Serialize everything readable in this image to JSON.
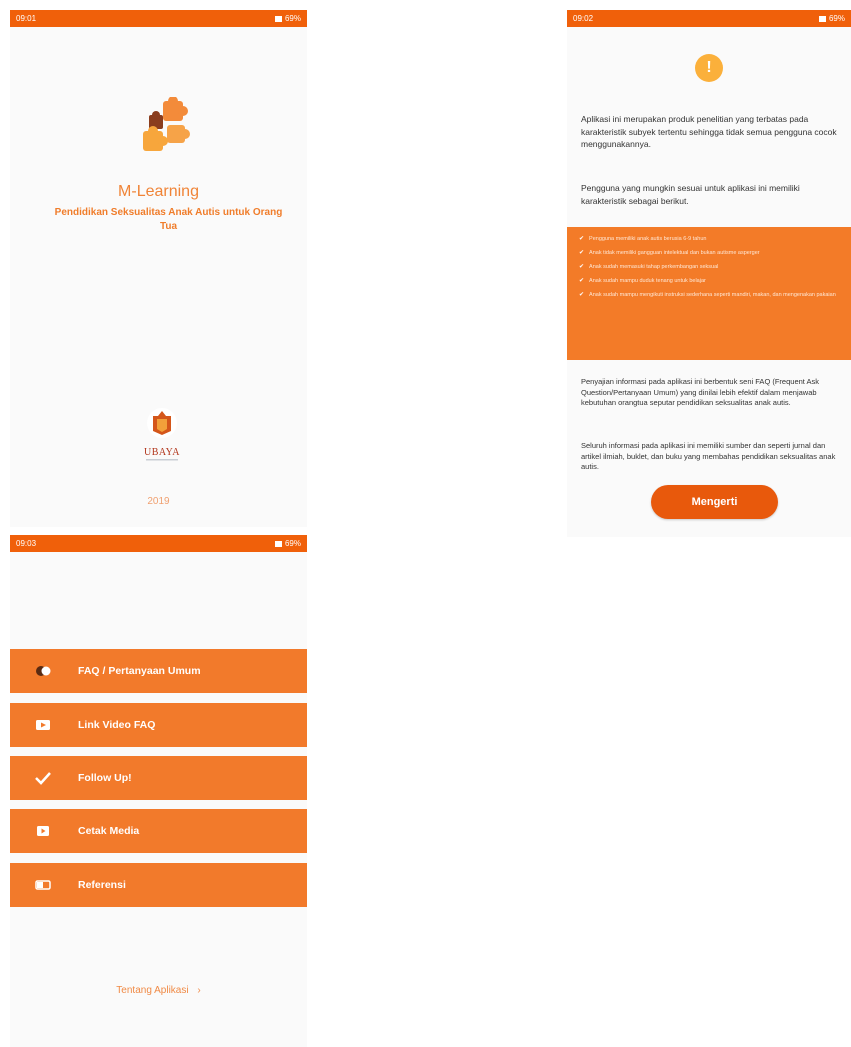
{
  "colors": {
    "status_bar": "#f0600a",
    "accent": "#f27a2b",
    "button": "#e8590c",
    "info_icon": "#fbb03b"
  },
  "screen1": {
    "status": {
      "time": "09:01",
      "battery": "69%"
    },
    "app_title": "M-Learning",
    "app_subtitle": "Pendidikan Seksualitas Anak Autis untuk Orang Tua",
    "logo_text": "UBAYA",
    "year": "2019"
  },
  "screen2": {
    "status": {
      "time": "09:02",
      "battery": "69%"
    },
    "icon": "info-icon",
    "para1": "Aplikasi ini merupakan produk penelitian yang terbatas pada karakteristik subyek tertentu sehingga tidak semua pengguna cocok menggunakannya.",
    "para2": "Pengguna yang mungkin sesuai untuk aplikasi ini memiliki karakteristik sebagai berikut.",
    "criteria": [
      "Pengguna memiliki anak autis berusia 6-9 tahun",
      "Anak tidak memiliki gangguan intelektual dan bukan autisme asperger",
      "Anak sudah memasuki tahap perkembangan seksual",
      "Anak sudah mampu duduk tenang untuk belajar",
      "Anak sudah mampu mengikuti instruksi sederhana seperti mandiri, makan, dan mengenakan pakaian"
    ],
    "para3": "Penyajian informasi pada aplikasi ini berbentuk seni FAQ (Frequent Ask Question/Pertanyaan Umum) yang dinilai lebih efektif dalam menjawab kebutuhan orangtua seputar pendidikan seksualitas anak autis.",
    "para4": "Seluruh informasi pada aplikasi ini memiliki sumber dan seperti jurnal dan artikel ilmiah, buklet, dan buku yang membahas pendidikan seksualitas anak autis.",
    "button_label": "Mengerti"
  },
  "screen3": {
    "status": {
      "time": "09:03",
      "battery": "69%"
    },
    "menu": [
      {
        "label": "FAQ / Pertanyaan Umum",
        "icon": "people-icon"
      },
      {
        "label": "Link Video FAQ",
        "icon": "video-icon"
      },
      {
        "label": "Follow Up!",
        "icon": "check-icon"
      },
      {
        "label": "Cetak Media",
        "icon": "print-icon"
      },
      {
        "label": "Referensi",
        "icon": "toggle-icon"
      }
    ],
    "about_link": "Tentang Aplikasi",
    "about_arrow": "›"
  }
}
